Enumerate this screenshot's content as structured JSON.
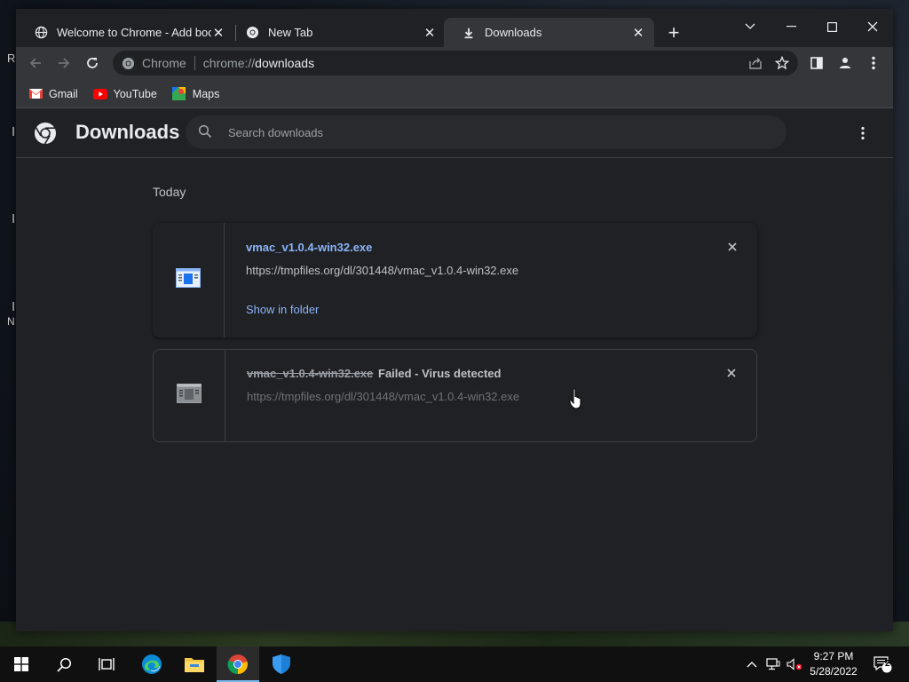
{
  "desktop": {
    "fragments": [
      "R",
      "I",
      "I",
      "I",
      "N"
    ]
  },
  "tabs": [
    {
      "title": "Welcome to Chrome - Add book",
      "icon": "globe-icon",
      "active": false
    },
    {
      "title": "New Tab",
      "icon": "chrome-icon",
      "active": false
    },
    {
      "title": "Downloads",
      "icon": "download-icon",
      "active": true
    }
  ],
  "omnibox": {
    "site_label": "Chrome",
    "url_scheme": "chrome://",
    "url_host": "downloads"
  },
  "bookmarks": [
    {
      "label": "Gmail",
      "icon": "gmail-icon"
    },
    {
      "label": "YouTube",
      "icon": "youtube-icon"
    },
    {
      "label": "Maps",
      "icon": "maps-icon"
    }
  ],
  "downloads_page": {
    "title": "Downloads",
    "search_placeholder": "Search downloads",
    "section_date": "Today",
    "items": [
      {
        "file_name": "vmac_v1.0.4-win32.exe",
        "url": "https://tmpfiles.org/dl/301448/vmac_v1.0.4-win32.exe",
        "action": "Show in folder",
        "status": ""
      },
      {
        "file_name": "vmac_v1.0.4-win32.exe",
        "url": "https://tmpfiles.org/dl/301448/vmac_v1.0.4-win32.exe",
        "action": "",
        "status": "Failed - Virus detected"
      }
    ]
  },
  "taskbar": {
    "apps": [
      "start-icon",
      "search-icon",
      "task-view-icon",
      "edge-icon",
      "file-explorer-icon",
      "chrome-icon",
      "windows-security-icon"
    ],
    "active_app": "chrome-icon",
    "time": "9:27 PM",
    "date": "5/28/2022",
    "notification_count": "2"
  },
  "colors": {
    "link": "#8ab4f8",
    "page_bg": "#202124",
    "toolbar_bg": "#35363a"
  }
}
